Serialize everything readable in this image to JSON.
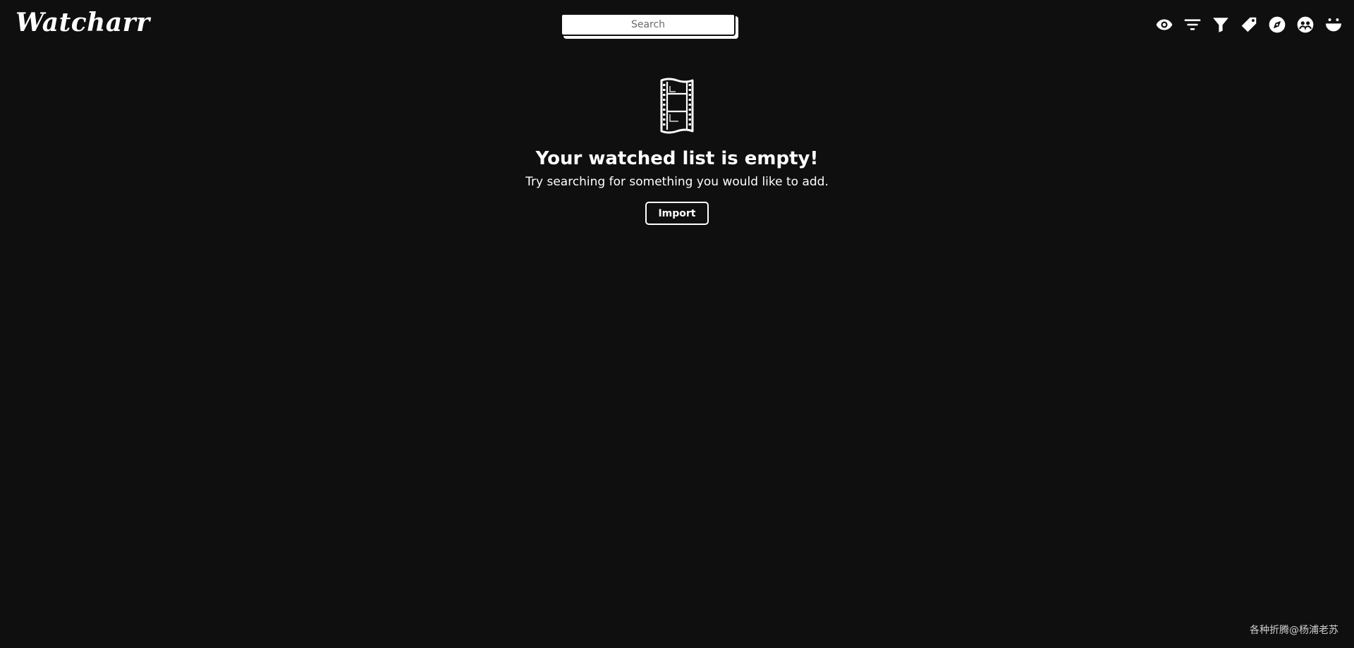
{
  "app": {
    "logo": "Watcharr"
  },
  "search": {
    "placeholder": "Search"
  },
  "nav": {
    "icons": [
      "eye-icon",
      "sort-icon",
      "filter-icon",
      "tag-icon",
      "compass-icon",
      "people-icon",
      "smiley-icon"
    ]
  },
  "empty_state": {
    "icon": "film-strip-icon",
    "title": "Your watched list is empty!",
    "subtitle": "Try searching for something you would like to add.",
    "import_label": "Import"
  },
  "watermark": {
    "text": "各种折腾@杨浦老苏"
  },
  "colors": {
    "background": "#0f0f0f",
    "foreground": "#ffffff"
  }
}
